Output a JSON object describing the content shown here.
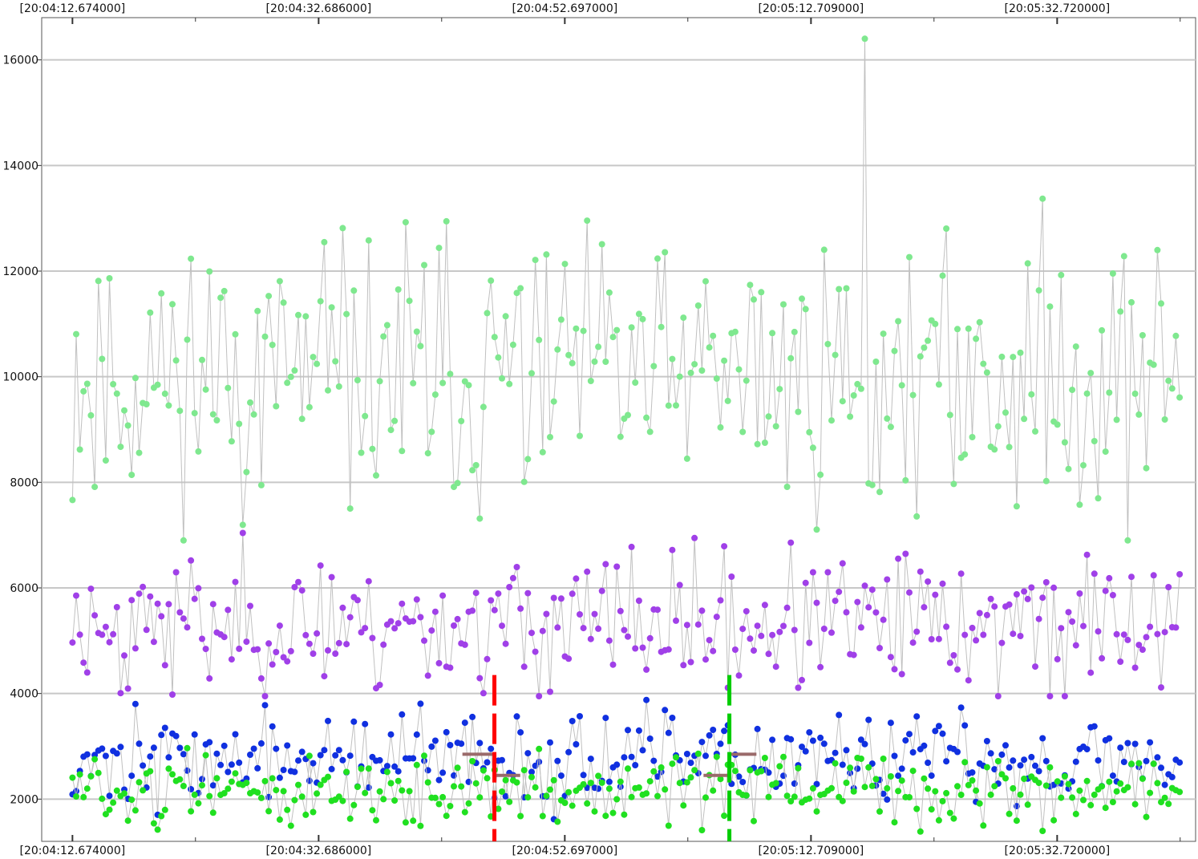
{
  "chart_data": {
    "type": "scatter",
    "x_tick_labels_top": [
      "[20:04:12.674000]",
      "[20:04:32.686000]",
      "[20:04:52.697000]",
      "[20:05:12.709000]",
      "[20:05:32.720000]"
    ],
    "x_tick_labels_bottom": [
      "[20:04:12.674000]",
      "[20:04:32.686000]",
      "[20:04:52.697000]",
      "[20:05:12.709000]",
      "[20:05:32.720000]"
    ],
    "x_tick_seconds": [
      0,
      20.012,
      40.023,
      60.035,
      80.046
    ],
    "y_tick_labels": [
      "2000",
      "4000",
      "6000",
      "8000",
      "10000",
      "12000",
      "14000",
      "16000"
    ],
    "y_ticks": [
      2000,
      4000,
      6000,
      8000,
      10000,
      12000,
      14000,
      16000
    ],
    "ylim": [
      1200,
      16800
    ],
    "xlim_seconds": [
      -2.5,
      91.3
    ],
    "x_range_seconds": [
      0,
      90
    ],
    "grid": "horizontal",
    "legend": "none",
    "colors": {
      "line": "#c0c0c0",
      "grid": "#c8c8c8",
      "light_green": "#7fe88f",
      "purple": "#a040e8",
      "blue": "#1030e0",
      "green": "#20e020",
      "marker_red": "#ff0000",
      "marker_green": "#00cc00",
      "cursor_bar": "#9a6a6a"
    },
    "series": [
      {
        "color": "#7fe88f",
        "connected": true,
        "mean": 10000,
        "spread": 1300,
        "min": 6900,
        "max": 16400,
        "spike_time": 64.3,
        "spike_value": 16400,
        "seed": 11,
        "count": 300
      },
      {
        "color": "#a040e8",
        "connected": true,
        "mean": 5300,
        "spread": 650,
        "min": 3950,
        "max": 7450,
        "seed": 23,
        "count": 300
      },
      {
        "color": "#1030e0",
        "connected": true,
        "mean": 2750,
        "spread": 420,
        "min": 1250,
        "max": 4450,
        "seed": 37,
        "count": 300
      },
      {
        "color": "#20e020",
        "connected": true,
        "mean": 2150,
        "spread": 330,
        "min": 1350,
        "max": 3150,
        "seed": 51,
        "count": 300
      }
    ],
    "markers": [
      {
        "color": "#ff0000",
        "time_seconds": 34.3,
        "y_from": 1200,
        "y_to": 4350,
        "label": ""
      },
      {
        "color": "#00cc00",
        "time_seconds": 53.4,
        "y_from": 1200,
        "y_to": 4350,
        "label": ""
      }
    ],
    "cursor_bars": [
      {
        "color": "#9a6a6a",
        "t_start": 31.7,
        "t_end": 34.3,
        "value": 2850
      },
      {
        "color": "#9a6a6a",
        "t_start": 34.3,
        "t_end": 36.4,
        "value": 2450
      },
      {
        "color": "#9a6a6a",
        "t_start": 51.3,
        "t_end": 53.4,
        "value": 2450
      },
      {
        "color": "#9a6a6a",
        "t_start": 53.4,
        "t_end": 55.6,
        "value": 2850
      }
    ]
  }
}
